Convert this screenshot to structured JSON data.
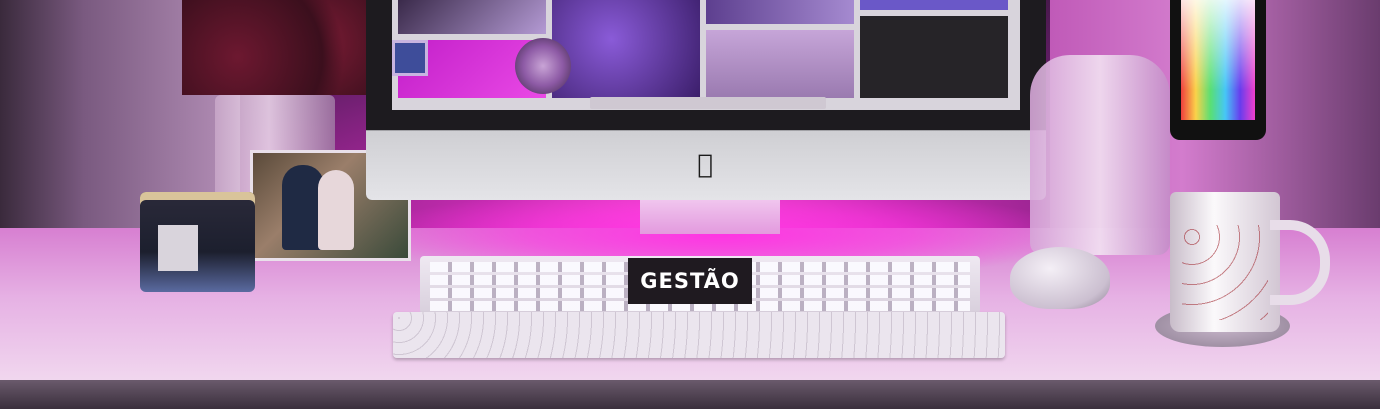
{
  "banner": {
    "title": "GESTÃO"
  },
  "scene": {
    "icons": [
      "apple-logo-icon"
    ],
    "colors": {
      "accent_glow": "#ff35e3",
      "badge_background": "#1f1a20",
      "badge_text": "#ffffff"
    }
  }
}
